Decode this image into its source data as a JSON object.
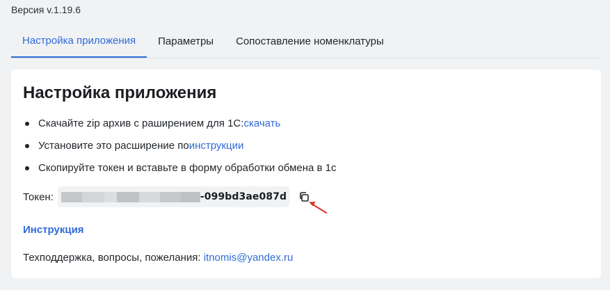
{
  "version": "Версия v.1.19.6",
  "tabs": [
    {
      "label": "Настройка приложения",
      "active": true
    },
    {
      "label": "Параметры",
      "active": false
    },
    {
      "label": "Сопоставление номенклатуры",
      "active": false
    }
  ],
  "card": {
    "title": "Настройка приложения",
    "steps": [
      {
        "text": "Скачайте zip архив с раширением для 1С: ",
        "link": "скачать"
      },
      {
        "text": "Установите это расширение по ",
        "link": "инструкции"
      },
      {
        "text": "Скопируйте токен и вставьте в форму обработки обмена в 1с",
        "link": ""
      }
    ],
    "token_label": "Токен:",
    "token_visible": "-099bd3ae087d",
    "instruction_heading": "Инструкция",
    "support_text": "Техподдержка, вопросы, пожелания: ",
    "support_email": "itnomis@yandex.ru"
  },
  "icons": {
    "copy": "copy-icon",
    "arrow": "arrow-icon"
  },
  "colors": {
    "accent": "#2f6bd8",
    "background": "#f1f2f4",
    "card": "#ffffff",
    "annotation_arrow": "#e0342b"
  }
}
